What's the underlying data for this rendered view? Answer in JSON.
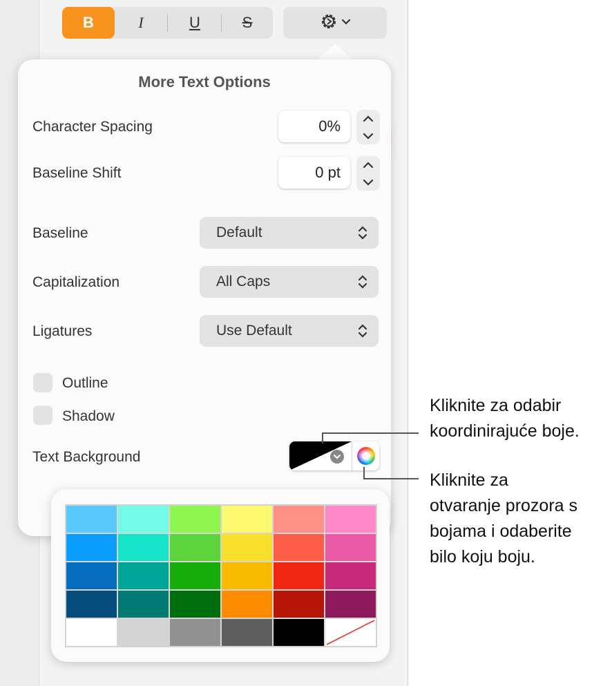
{
  "toolbar": {
    "bold_label": "B",
    "italic_label": "I",
    "underline_label": "U",
    "strikethrough_label": "S",
    "accent_color": "#f7931e"
  },
  "popover": {
    "title": "More Text Options",
    "character_spacing": {
      "label": "Character Spacing",
      "value": "0%"
    },
    "baseline_shift": {
      "label": "Baseline Shift",
      "value": "0 pt"
    },
    "baseline": {
      "label": "Baseline",
      "value": "Default"
    },
    "capitalization": {
      "label": "Capitalization",
      "value": "All Caps"
    },
    "ligatures": {
      "label": "Ligatures",
      "value": "Use Default"
    },
    "outline": {
      "label": "Outline",
      "checked": false
    },
    "shadow": {
      "label": "Shadow",
      "checked": false
    },
    "text_background": {
      "label": "Text Background"
    }
  },
  "palette": {
    "colors": [
      [
        "#5ac8fa",
        "#74fbe8",
        "#8ff54f",
        "#fcf970",
        "#fe9088",
        "#fe88c8"
      ],
      [
        "#0a9dfb",
        "#17e3c8",
        "#5dd43b",
        "#f8e02c",
        "#fc5e4a",
        "#eb5aa7"
      ],
      [
        "#046cba",
        "#00a497",
        "#18ac0d",
        "#f8bb00",
        "#ee2614",
        "#c72a78"
      ],
      [
        "#054b7c",
        "#017a74",
        "#006d0e",
        "#fe8c00",
        "#b51607",
        "#8e1a5c"
      ],
      [
        "#ffffff",
        "#d4d4d4",
        "#919191",
        "#5e5e5e",
        "#000000",
        "none"
      ]
    ]
  },
  "callouts": [
    {
      "lines": [
        "Kliknite za odabir",
        "koordinirajuće boje."
      ]
    },
    {
      "lines": [
        "Kliknite za",
        "otvaranje prozora s",
        "bojama i odaberite",
        "bilo koju boju."
      ]
    }
  ]
}
